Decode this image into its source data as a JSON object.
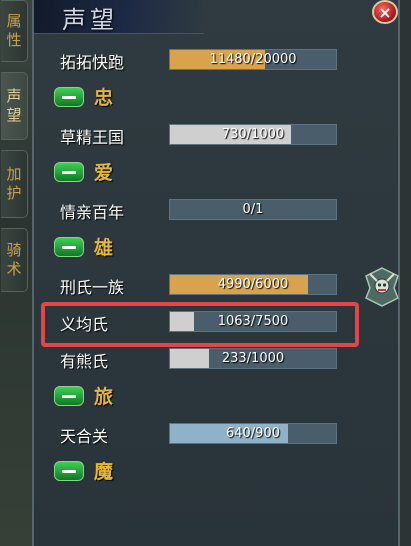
{
  "side_tabs": [
    {
      "label": "属\n性"
    },
    {
      "label": "声\n望"
    },
    {
      "label": "加\n护"
    },
    {
      "label": "骑\n术"
    }
  ],
  "panel": {
    "title": "声望",
    "close_label": "×"
  },
  "reputations": [
    {
      "name": "拓拓快跑",
      "current": 11480,
      "max": 20000,
      "text": "11480/20000",
      "color": "#d9a24c"
    },
    {
      "category": "忠"
    },
    {
      "name": "草精王国",
      "current": 730,
      "max": 1000,
      "text": "730/1000",
      "color": "#cfcfcf"
    },
    {
      "category": "爱"
    },
    {
      "name": "情亲百年",
      "current": 0,
      "max": 1,
      "text": "0/1",
      "color": "#cfcfcf"
    },
    {
      "category": "雄"
    },
    {
      "name": "刑氏一族",
      "current": 4990,
      "max": 6000,
      "text": "4990/6000",
      "color": "#d9a24c"
    },
    {
      "name": "义均氏",
      "current": 1063,
      "max": 7500,
      "text": "1063/7500",
      "color": "#cfcfcf"
    },
    {
      "name": "有熊氏",
      "current": 233,
      "max": 1000,
      "text": "233/1000",
      "color": "#cfcfcf"
    },
    {
      "category": "旅"
    },
    {
      "name": "天合关",
      "current": 640,
      "max": 900,
      "text": "640/900",
      "color": "#8fb2c8"
    },
    {
      "category": "魔"
    }
  ],
  "scroll": {
    "up": "▲",
    "down": "▼"
  }
}
